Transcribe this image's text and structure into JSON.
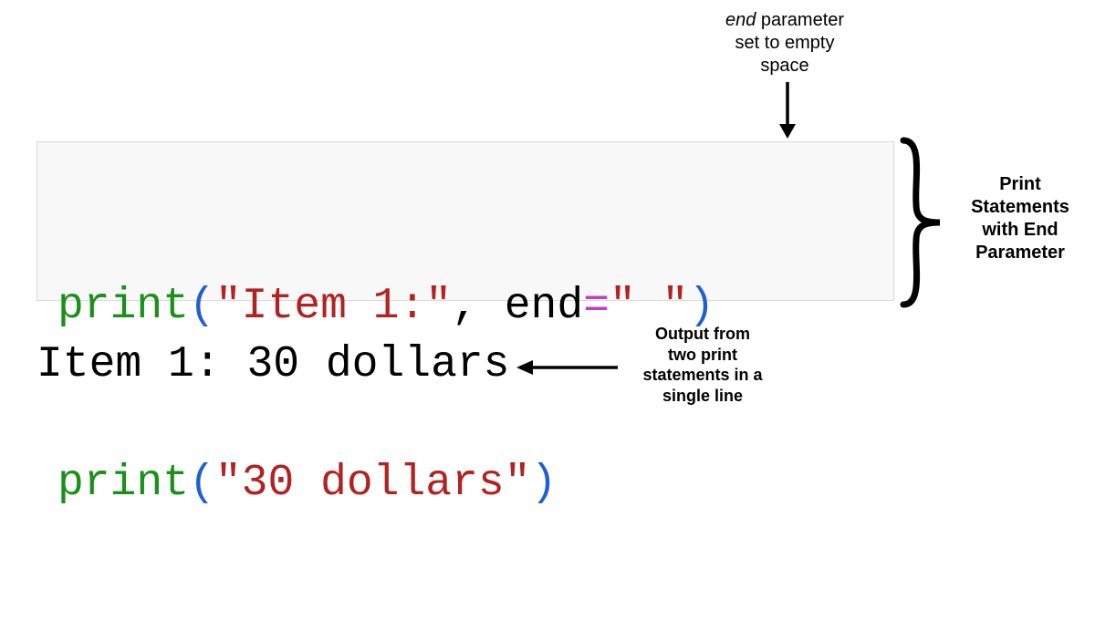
{
  "labels": {
    "top_italic": "end",
    "top_rest": " parameter\nset to empty\nspace",
    "right": "Print\nStatements\nwith End\nParameter",
    "output": "Output from\ntwo print\nstatements in a\nsingle line"
  },
  "code": {
    "line1": {
      "tokens": [
        {
          "t": "print",
          "c": "tok-kw"
        },
        {
          "t": "(",
          "c": "tok-paren"
        },
        {
          "t": "\"Item 1:\"",
          "c": "tok-str"
        },
        {
          "t": ", ",
          "c": "tok-comma"
        },
        {
          "t": "end",
          "c": "tok-name"
        },
        {
          "t": "=",
          "c": "tok-op"
        },
        {
          "t": "\" \"",
          "c": "tok-str"
        },
        {
          "t": ")",
          "c": "tok-paren"
        }
      ]
    },
    "line2": {
      "tokens": [
        {
          "t": "print",
          "c": "tok-kw"
        },
        {
          "t": "(",
          "c": "tok-paren"
        },
        {
          "t": "\"30 dollars\"",
          "c": "tok-str"
        },
        {
          "t": ")",
          "c": "tok-paren"
        }
      ]
    }
  },
  "output_text": "Item 1: 30 dollars"
}
